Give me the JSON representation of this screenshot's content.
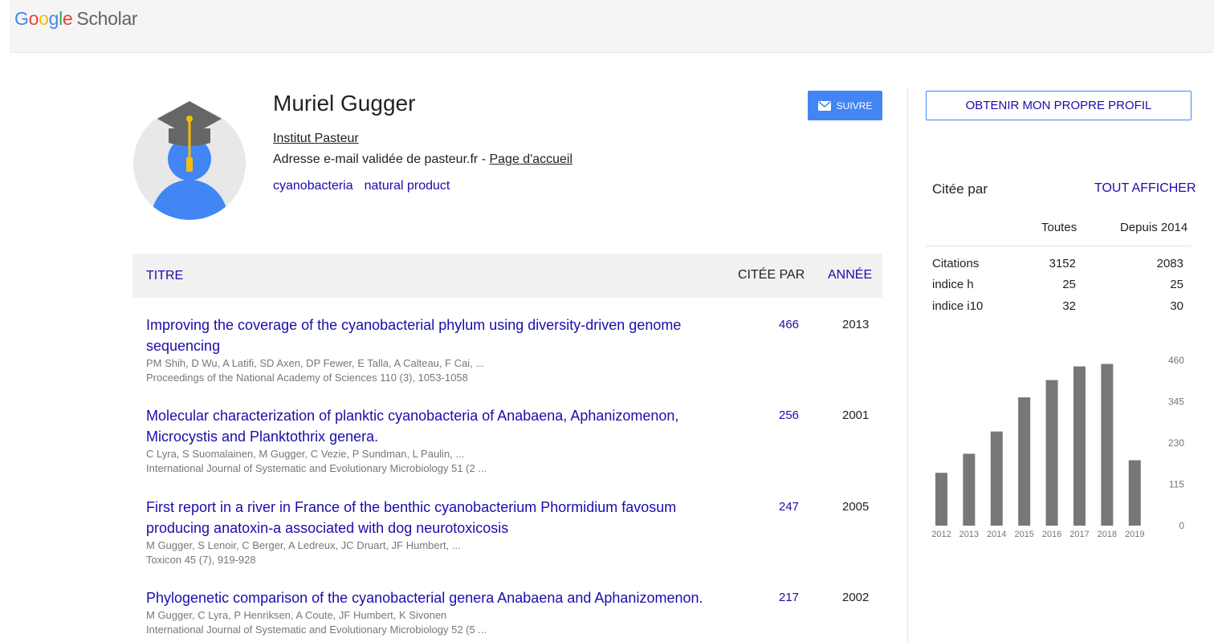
{
  "header": {
    "logo_google": [
      "G",
      "o",
      "o",
      "g",
      "l",
      "e"
    ],
    "logo_scholar": "Scholar"
  },
  "profile": {
    "name": "Muriel Gugger",
    "affiliation": "Institut Pasteur",
    "email_text": "Adresse e-mail validée de pasteur.fr - ",
    "homepage_link": "Page d'accueil",
    "interests": [
      "cyanobacteria",
      "natural product"
    ],
    "follow_label": "SUIVRE",
    "follow_icon": "envelope-icon"
  },
  "table": {
    "col_title": "TITRE",
    "col_cited": "CITÉE PAR",
    "col_year": "ANNÉE"
  },
  "publications": [
    {
      "title": "Improving the coverage of the cyanobacterial phylum using diversity-driven genome sequencing",
      "authors": "PM Shih, D Wu, A Latifi, SD Axen, DP Fewer, E Talla, A Calteau, F Cai, ...",
      "venue": "Proceedings of the National Academy of Sciences 110 (3), 1053-1058",
      "cited": "466",
      "year": "2013"
    },
    {
      "title": "Molecular characterization of planktic cyanobacteria of Anabaena, Aphanizomenon, Microcystis and Planktothrix genera.",
      "authors": "C Lyra, S Suomalainen, M Gugger, C Vezie, P Sundman, L Paulin, ...",
      "venue": "International Journal of Systematic and Evolutionary Microbiology 51 (2 ...",
      "cited": "256",
      "year": "2001"
    },
    {
      "title": "First report in a river in France of the benthic cyanobacterium Phormidium favosum producing anatoxin-a associated with dog neurotoxicosis",
      "authors": "M Gugger, S Lenoir, C Berger, A Ledreux, JC Druart, JF Humbert, ...",
      "venue": "Toxicon 45 (7), 919-928",
      "cited": "247",
      "year": "2005"
    },
    {
      "title": "Phylogenetic comparison of the cyanobacterial genera Anabaena and Aphanizomenon.",
      "authors": "M Gugger, C Lyra, P Henriksen, A Coute, JF Humbert, K Sivonen",
      "venue": "International Journal of Systematic and Evolutionary Microbiology 52 (5 ...",
      "cited": "217",
      "year": "2002"
    }
  ],
  "sidebar": {
    "own_profile_label": "OBTENIR MON PROPRE PROFIL",
    "cited_by_label": "Citée par",
    "show_all_label": "TOUT AFFICHER",
    "col_all": "Toutes",
    "col_since": "Depuis 2014",
    "stats": [
      {
        "label": "Citations",
        "all": "3152",
        "since": "2083"
      },
      {
        "label": "indice h",
        "all": "25",
        "since": "25"
      },
      {
        "label": "indice i10",
        "all": "32",
        "since": "30"
      }
    ]
  },
  "colors": {
    "link": "#1a0dab",
    "accent": "#4285f4",
    "bar": "#777777"
  },
  "chart_data": {
    "type": "bar",
    "categories": [
      "2012",
      "2013",
      "2014",
      "2015",
      "2016",
      "2017",
      "2018",
      "2019"
    ],
    "values": [
      147,
      200,
      262,
      357,
      405,
      443,
      450,
      182
    ],
    "yticks": [
      0,
      115,
      230,
      345,
      460
    ],
    "ylim": [
      0,
      460
    ],
    "grid": false
  }
}
